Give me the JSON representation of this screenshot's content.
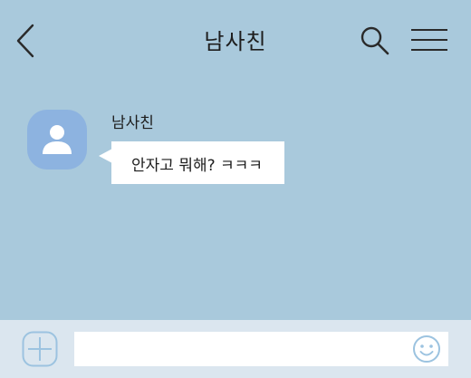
{
  "header": {
    "title": "남사친",
    "back_icon": "chevron-left-icon",
    "search_icon": "search-icon",
    "menu_icon": "hamburger-menu-icon"
  },
  "conversation": {
    "messages": [
      {
        "sender": "남사친",
        "text": "안자고 뭐해? ㅋㅋㅋ",
        "avatar_icon": "user-icon",
        "avatar_color": "#8db3e0"
      }
    ]
  },
  "composer": {
    "input_value": "",
    "input_placeholder": "",
    "add_icon": "plus-icon",
    "emoji_icon": "smiley-icon"
  },
  "colors": {
    "background": "#a9c9dc",
    "composer_background": "#dbe6ef",
    "bubble": "#ffffff",
    "icon_accent": "#9cc3e0"
  }
}
